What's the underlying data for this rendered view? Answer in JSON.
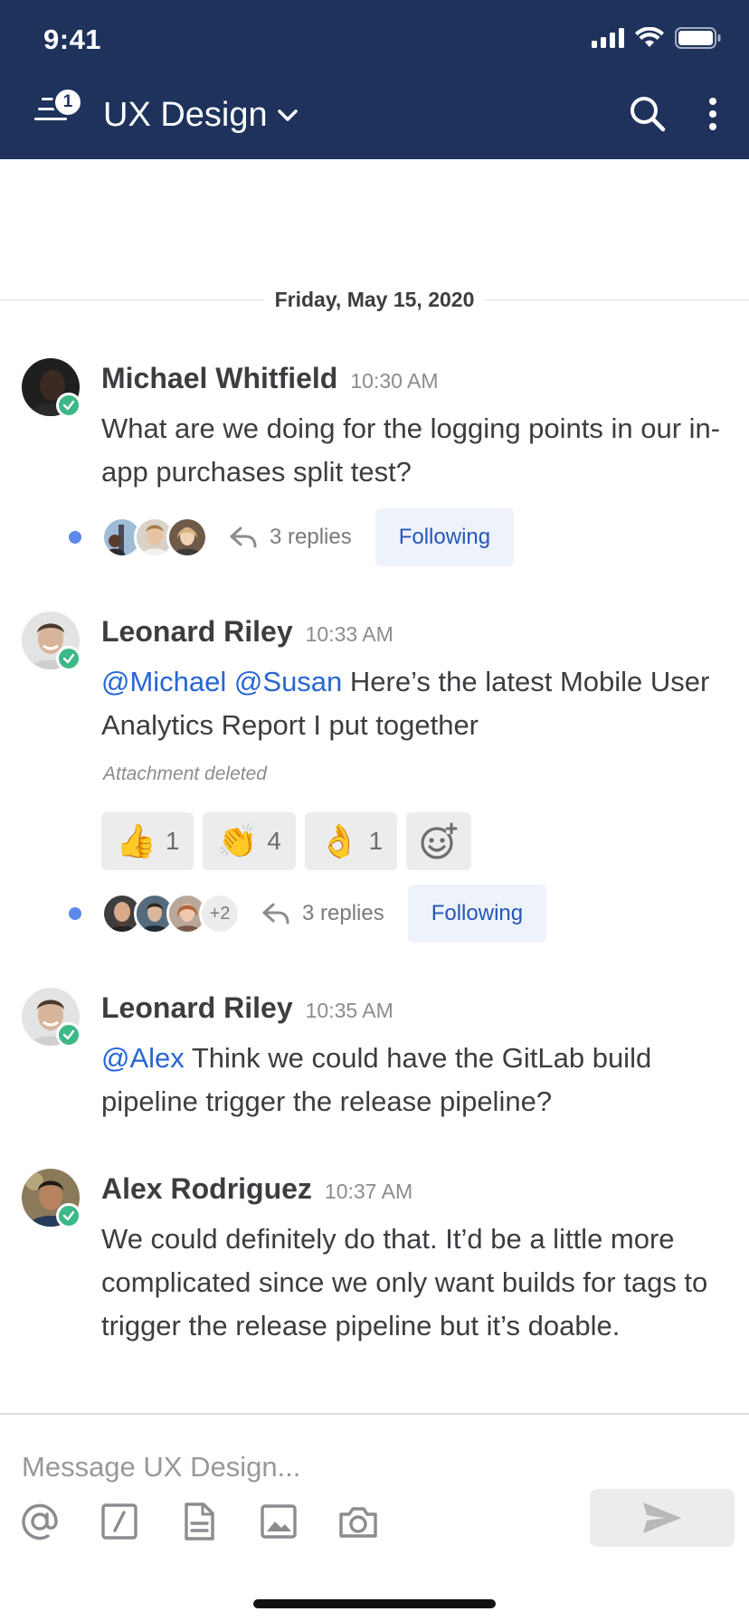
{
  "status_bar": {
    "time": "9:41"
  },
  "header": {
    "menu_badge": "1",
    "channel_name": "UX Design",
    "icons": [
      "menu-icon",
      "chevron-down-icon",
      "search-icon",
      "more-vertical-icon"
    ]
  },
  "date_separator": "Friday, May 15, 2020",
  "posts": [
    {
      "author": "Michael Whitfield",
      "time": "10:30 AM",
      "text": "What are we doing for the logging points in our in-app purchases split test?",
      "thread": {
        "replies": "3 replies",
        "follow_label": "Following"
      }
    },
    {
      "author": "Leonard Riley",
      "time": "10:33 AM",
      "mention_1": "@Michael",
      "mention_2": "@Susan",
      "text": " Here’s the latest Mobile User Analytics Report I put together",
      "attachment_note": "Attachment deleted",
      "reactions": [
        {
          "emoji": "👍",
          "count": "1"
        },
        {
          "emoji": "👏",
          "count": "4"
        },
        {
          "emoji": "👌",
          "count": "1"
        }
      ],
      "thread": {
        "more_participants": "+2",
        "replies": "3 replies",
        "follow_label": "Following"
      }
    },
    {
      "author": "Leonard Riley",
      "time": "10:35 AM",
      "mention_1": "@Alex",
      "text": " Think we could have the GitLab build pipeline trigger the release pipeline?"
    },
    {
      "author": "Alex Rodriguez",
      "time": "10:37 AM",
      "text": "We could definitely do that. It’d be a little more complicated since we only want builds for tags to trigger the release pipeline but it’s doable."
    }
  ],
  "composer": {
    "placeholder": "Message UX Design...",
    "tools": [
      "at-mention-icon",
      "slash-command-icon",
      "file-icon",
      "image-icon",
      "camera-icon"
    ],
    "send_icon": "send-icon"
  },
  "colors": {
    "header_bg": "#1e325c",
    "mention": "#2766d2",
    "online": "#3db887",
    "unread_dot": "#5d89ea",
    "follow_bg": "#eef2fb"
  }
}
